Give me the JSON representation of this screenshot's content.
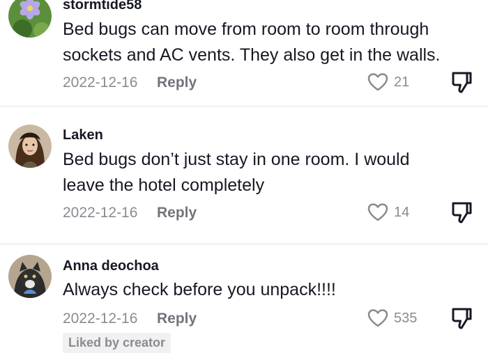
{
  "comments": [
    {
      "username": "stormtide58",
      "text_lines": [
        "Bed bugs can move from room to room through",
        "sockets and AC vents. They also get in the walls."
      ],
      "date": "2022-12-16",
      "reply_label": "Reply",
      "likes": "21",
      "avatar": "flower-photo"
    },
    {
      "username": "Laken",
      "text_lines": [
        "Bed bugs don’t just stay in one room. I would",
        "leave the hotel completely"
      ],
      "date": "2022-12-16",
      "reply_label": "Reply",
      "likes": "14",
      "avatar": "person-photo"
    },
    {
      "username": "Anna deochoa",
      "text_lines": [
        "Always check before you unpack!!!!"
      ],
      "date": "2022-12-16",
      "reply_label": "Reply",
      "likes": "535",
      "avatar": "cat-photo",
      "badge": "Liked by creator"
    }
  ],
  "icons": {
    "like": "heart-outline-icon",
    "dislike": "thumbs-down-icon"
  },
  "colors": {
    "text": "#161823",
    "meta": "#8a8b91",
    "divider": "#e3e3e6"
  }
}
